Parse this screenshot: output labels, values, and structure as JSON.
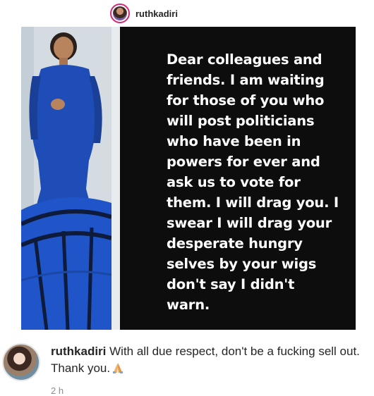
{
  "post": {
    "username": "ruthkadiri",
    "card_text": "Dear colleagues and\nfriends. I am waiting\nfor those of you who\nwill post politicians\nwho have been in\npowers for ever and\nask us to vote for\nthem.  I will drag you. I\nswear I will drag your\ndesperate hungry\nselves by your wigs\ndon't say I didn't\nwarn."
  },
  "comment": {
    "username": "ruthkadiri",
    "text": " With all due respect, don't be a fucking sell out. Thank you.",
    "emoji_icon": "folded-hands-icon",
    "timestamp": "2 h"
  },
  "colors": {
    "card_background": "#0d0d0d",
    "card_text": "#ffffff",
    "dress_blue": "#1f4db8",
    "avatar_ring": "#d62976"
  }
}
